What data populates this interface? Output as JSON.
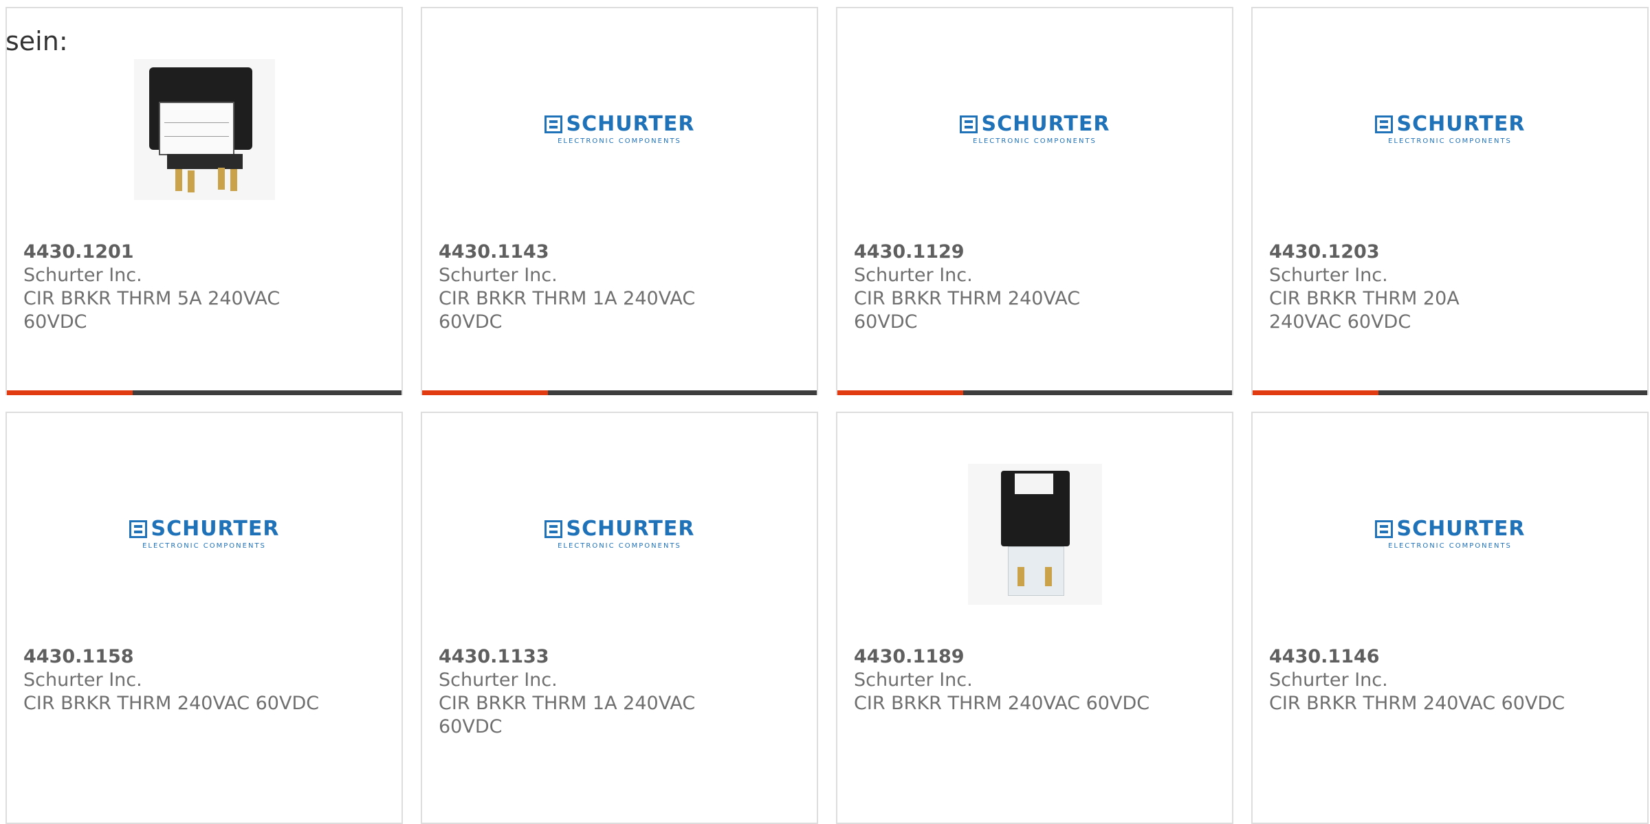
{
  "intro_text": "sein:",
  "products": [
    {
      "part_number": "4430.1201",
      "manufacturer": "Schurter Inc.",
      "description": "CIR BRKR THRM 5A 240VAC 60VDC",
      "image": "rocker-breaker-photo"
    },
    {
      "part_number": "4430.1143",
      "manufacturer": "Schurter Inc.",
      "description": "CIR BRKR THRM 1A 240VAC 60VDC",
      "image": "schurter-logo"
    },
    {
      "part_number": "4430.1129",
      "manufacturer": "Schurter Inc.",
      "description": "CIR BRKR THRM 240VAC 60VDC",
      "image": "schurter-logo"
    },
    {
      "part_number": "4430.1203",
      "manufacturer": "Schurter Inc.",
      "description": "CIR BRKR THRM 20A 240VAC 60VDC",
      "image": "schurter-logo"
    },
    {
      "part_number": "4430.1158",
      "manufacturer": "Schurter Inc.",
      "description": "CIR BRKR THRM 240VAC 60VDC",
      "image": "schurter-logo"
    },
    {
      "part_number": "4430.1133",
      "manufacturer": "Schurter Inc.",
      "description": "CIR BRKR THRM 1A 240VAC 60VDC",
      "image": "schurter-logo"
    },
    {
      "part_number": "4430.1189",
      "manufacturer": "Schurter Inc.",
      "description": "CIR BRKR THRM 240VAC 60VDC",
      "image": "tall-breaker-photo"
    },
    {
      "part_number": "4430.1146",
      "manufacturer": "Schurter Inc.",
      "description": "CIR BRKR THRM 240VAC 60VDC",
      "image": "schurter-logo"
    }
  ],
  "logo": {
    "word": "SCHURTER",
    "tagline": "ELECTRONIC COMPONENTS"
  },
  "colors": {
    "accent": "#e13b12",
    "bar": "#3d3d3d",
    "logo_blue": "#1f71b8",
    "text": "#6f6f6f",
    "border": "#dddddd"
  }
}
